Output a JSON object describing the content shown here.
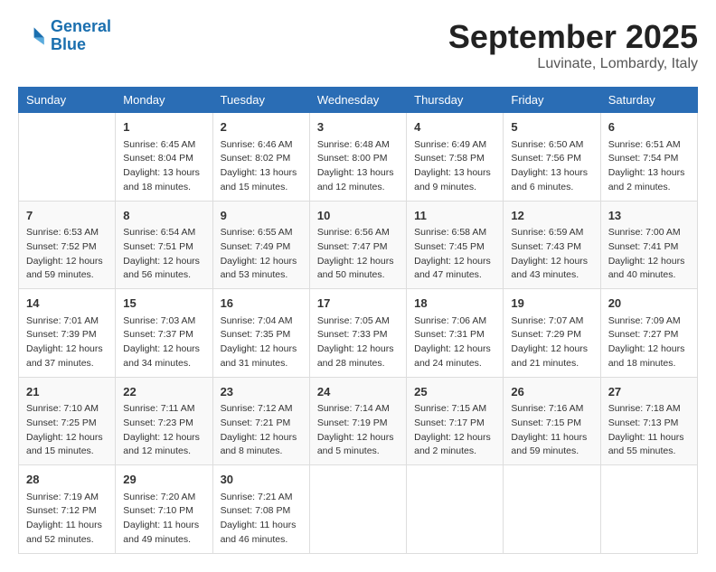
{
  "logo": {
    "line1": "General",
    "line2": "Blue"
  },
  "title": "September 2025",
  "location": "Luvinate, Lombardy, Italy",
  "weekdays": [
    "Sunday",
    "Monday",
    "Tuesday",
    "Wednesday",
    "Thursday",
    "Friday",
    "Saturday"
  ],
  "weeks": [
    [
      {
        "day": "",
        "info": ""
      },
      {
        "day": "1",
        "info": "Sunrise: 6:45 AM\nSunset: 8:04 PM\nDaylight: 13 hours\nand 18 minutes."
      },
      {
        "day": "2",
        "info": "Sunrise: 6:46 AM\nSunset: 8:02 PM\nDaylight: 13 hours\nand 15 minutes."
      },
      {
        "day": "3",
        "info": "Sunrise: 6:48 AM\nSunset: 8:00 PM\nDaylight: 13 hours\nand 12 minutes."
      },
      {
        "day": "4",
        "info": "Sunrise: 6:49 AM\nSunset: 7:58 PM\nDaylight: 13 hours\nand 9 minutes."
      },
      {
        "day": "5",
        "info": "Sunrise: 6:50 AM\nSunset: 7:56 PM\nDaylight: 13 hours\nand 6 minutes."
      },
      {
        "day": "6",
        "info": "Sunrise: 6:51 AM\nSunset: 7:54 PM\nDaylight: 13 hours\nand 2 minutes."
      }
    ],
    [
      {
        "day": "7",
        "info": "Sunrise: 6:53 AM\nSunset: 7:52 PM\nDaylight: 12 hours\nand 59 minutes."
      },
      {
        "day": "8",
        "info": "Sunrise: 6:54 AM\nSunset: 7:51 PM\nDaylight: 12 hours\nand 56 minutes."
      },
      {
        "day": "9",
        "info": "Sunrise: 6:55 AM\nSunset: 7:49 PM\nDaylight: 12 hours\nand 53 minutes."
      },
      {
        "day": "10",
        "info": "Sunrise: 6:56 AM\nSunset: 7:47 PM\nDaylight: 12 hours\nand 50 minutes."
      },
      {
        "day": "11",
        "info": "Sunrise: 6:58 AM\nSunset: 7:45 PM\nDaylight: 12 hours\nand 47 minutes."
      },
      {
        "day": "12",
        "info": "Sunrise: 6:59 AM\nSunset: 7:43 PM\nDaylight: 12 hours\nand 43 minutes."
      },
      {
        "day": "13",
        "info": "Sunrise: 7:00 AM\nSunset: 7:41 PM\nDaylight: 12 hours\nand 40 minutes."
      }
    ],
    [
      {
        "day": "14",
        "info": "Sunrise: 7:01 AM\nSunset: 7:39 PM\nDaylight: 12 hours\nand 37 minutes."
      },
      {
        "day": "15",
        "info": "Sunrise: 7:03 AM\nSunset: 7:37 PM\nDaylight: 12 hours\nand 34 minutes."
      },
      {
        "day": "16",
        "info": "Sunrise: 7:04 AM\nSunset: 7:35 PM\nDaylight: 12 hours\nand 31 minutes."
      },
      {
        "day": "17",
        "info": "Sunrise: 7:05 AM\nSunset: 7:33 PM\nDaylight: 12 hours\nand 28 minutes."
      },
      {
        "day": "18",
        "info": "Sunrise: 7:06 AM\nSunset: 7:31 PM\nDaylight: 12 hours\nand 24 minutes."
      },
      {
        "day": "19",
        "info": "Sunrise: 7:07 AM\nSunset: 7:29 PM\nDaylight: 12 hours\nand 21 minutes."
      },
      {
        "day": "20",
        "info": "Sunrise: 7:09 AM\nSunset: 7:27 PM\nDaylight: 12 hours\nand 18 minutes."
      }
    ],
    [
      {
        "day": "21",
        "info": "Sunrise: 7:10 AM\nSunset: 7:25 PM\nDaylight: 12 hours\nand 15 minutes."
      },
      {
        "day": "22",
        "info": "Sunrise: 7:11 AM\nSunset: 7:23 PM\nDaylight: 12 hours\nand 12 minutes."
      },
      {
        "day": "23",
        "info": "Sunrise: 7:12 AM\nSunset: 7:21 PM\nDaylight: 12 hours\nand 8 minutes."
      },
      {
        "day": "24",
        "info": "Sunrise: 7:14 AM\nSunset: 7:19 PM\nDaylight: 12 hours\nand 5 minutes."
      },
      {
        "day": "25",
        "info": "Sunrise: 7:15 AM\nSunset: 7:17 PM\nDaylight: 12 hours\nand 2 minutes."
      },
      {
        "day": "26",
        "info": "Sunrise: 7:16 AM\nSunset: 7:15 PM\nDaylight: 11 hours\nand 59 minutes."
      },
      {
        "day": "27",
        "info": "Sunrise: 7:18 AM\nSunset: 7:13 PM\nDaylight: 11 hours\nand 55 minutes."
      }
    ],
    [
      {
        "day": "28",
        "info": "Sunrise: 7:19 AM\nSunset: 7:12 PM\nDaylight: 11 hours\nand 52 minutes."
      },
      {
        "day": "29",
        "info": "Sunrise: 7:20 AM\nSunset: 7:10 PM\nDaylight: 11 hours\nand 49 minutes."
      },
      {
        "day": "30",
        "info": "Sunrise: 7:21 AM\nSunset: 7:08 PM\nDaylight: 11 hours\nand 46 minutes."
      },
      {
        "day": "",
        "info": ""
      },
      {
        "day": "",
        "info": ""
      },
      {
        "day": "",
        "info": ""
      },
      {
        "day": "",
        "info": ""
      }
    ]
  ]
}
